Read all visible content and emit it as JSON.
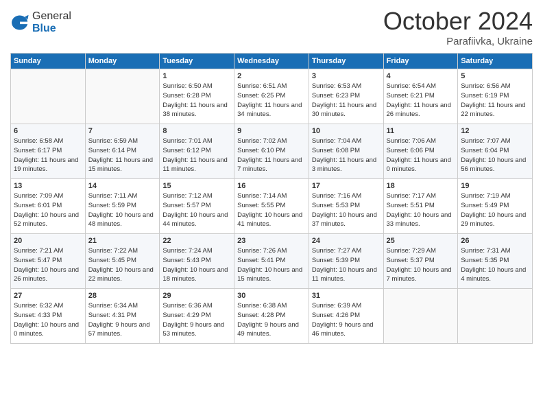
{
  "header": {
    "logo_general": "General",
    "logo_blue": "Blue",
    "month": "October 2024",
    "location": "Parafiivka, Ukraine"
  },
  "days_of_week": [
    "Sunday",
    "Monday",
    "Tuesday",
    "Wednesday",
    "Thursday",
    "Friday",
    "Saturday"
  ],
  "weeks": [
    [
      {
        "day": "",
        "sunrise": "",
        "sunset": "",
        "daylight": ""
      },
      {
        "day": "",
        "sunrise": "",
        "sunset": "",
        "daylight": ""
      },
      {
        "day": "1",
        "sunrise": "Sunrise: 6:50 AM",
        "sunset": "Sunset: 6:28 PM",
        "daylight": "Daylight: 11 hours and 38 minutes."
      },
      {
        "day": "2",
        "sunrise": "Sunrise: 6:51 AM",
        "sunset": "Sunset: 6:25 PM",
        "daylight": "Daylight: 11 hours and 34 minutes."
      },
      {
        "day": "3",
        "sunrise": "Sunrise: 6:53 AM",
        "sunset": "Sunset: 6:23 PM",
        "daylight": "Daylight: 11 hours and 30 minutes."
      },
      {
        "day": "4",
        "sunrise": "Sunrise: 6:54 AM",
        "sunset": "Sunset: 6:21 PM",
        "daylight": "Daylight: 11 hours and 26 minutes."
      },
      {
        "day": "5",
        "sunrise": "Sunrise: 6:56 AM",
        "sunset": "Sunset: 6:19 PM",
        "daylight": "Daylight: 11 hours and 22 minutes."
      }
    ],
    [
      {
        "day": "6",
        "sunrise": "Sunrise: 6:58 AM",
        "sunset": "Sunset: 6:17 PM",
        "daylight": "Daylight: 11 hours and 19 minutes."
      },
      {
        "day": "7",
        "sunrise": "Sunrise: 6:59 AM",
        "sunset": "Sunset: 6:14 PM",
        "daylight": "Daylight: 11 hours and 15 minutes."
      },
      {
        "day": "8",
        "sunrise": "Sunrise: 7:01 AM",
        "sunset": "Sunset: 6:12 PM",
        "daylight": "Daylight: 11 hours and 11 minutes."
      },
      {
        "day": "9",
        "sunrise": "Sunrise: 7:02 AM",
        "sunset": "Sunset: 6:10 PM",
        "daylight": "Daylight: 11 hours and 7 minutes."
      },
      {
        "day": "10",
        "sunrise": "Sunrise: 7:04 AM",
        "sunset": "Sunset: 6:08 PM",
        "daylight": "Daylight: 11 hours and 3 minutes."
      },
      {
        "day": "11",
        "sunrise": "Sunrise: 7:06 AM",
        "sunset": "Sunset: 6:06 PM",
        "daylight": "Daylight: 11 hours and 0 minutes."
      },
      {
        "day": "12",
        "sunrise": "Sunrise: 7:07 AM",
        "sunset": "Sunset: 6:04 PM",
        "daylight": "Daylight: 10 hours and 56 minutes."
      }
    ],
    [
      {
        "day": "13",
        "sunrise": "Sunrise: 7:09 AM",
        "sunset": "Sunset: 6:01 PM",
        "daylight": "Daylight: 10 hours and 52 minutes."
      },
      {
        "day": "14",
        "sunrise": "Sunrise: 7:11 AM",
        "sunset": "Sunset: 5:59 PM",
        "daylight": "Daylight: 10 hours and 48 minutes."
      },
      {
        "day": "15",
        "sunrise": "Sunrise: 7:12 AM",
        "sunset": "Sunset: 5:57 PM",
        "daylight": "Daylight: 10 hours and 44 minutes."
      },
      {
        "day": "16",
        "sunrise": "Sunrise: 7:14 AM",
        "sunset": "Sunset: 5:55 PM",
        "daylight": "Daylight: 10 hours and 41 minutes."
      },
      {
        "day": "17",
        "sunrise": "Sunrise: 7:16 AM",
        "sunset": "Sunset: 5:53 PM",
        "daylight": "Daylight: 10 hours and 37 minutes."
      },
      {
        "day": "18",
        "sunrise": "Sunrise: 7:17 AM",
        "sunset": "Sunset: 5:51 PM",
        "daylight": "Daylight: 10 hours and 33 minutes."
      },
      {
        "day": "19",
        "sunrise": "Sunrise: 7:19 AM",
        "sunset": "Sunset: 5:49 PM",
        "daylight": "Daylight: 10 hours and 29 minutes."
      }
    ],
    [
      {
        "day": "20",
        "sunrise": "Sunrise: 7:21 AM",
        "sunset": "Sunset: 5:47 PM",
        "daylight": "Daylight: 10 hours and 26 minutes."
      },
      {
        "day": "21",
        "sunrise": "Sunrise: 7:22 AM",
        "sunset": "Sunset: 5:45 PM",
        "daylight": "Daylight: 10 hours and 22 minutes."
      },
      {
        "day": "22",
        "sunrise": "Sunrise: 7:24 AM",
        "sunset": "Sunset: 5:43 PM",
        "daylight": "Daylight: 10 hours and 18 minutes."
      },
      {
        "day": "23",
        "sunrise": "Sunrise: 7:26 AM",
        "sunset": "Sunset: 5:41 PM",
        "daylight": "Daylight: 10 hours and 15 minutes."
      },
      {
        "day": "24",
        "sunrise": "Sunrise: 7:27 AM",
        "sunset": "Sunset: 5:39 PM",
        "daylight": "Daylight: 10 hours and 11 minutes."
      },
      {
        "day": "25",
        "sunrise": "Sunrise: 7:29 AM",
        "sunset": "Sunset: 5:37 PM",
        "daylight": "Daylight: 10 hours and 7 minutes."
      },
      {
        "day": "26",
        "sunrise": "Sunrise: 7:31 AM",
        "sunset": "Sunset: 5:35 PM",
        "daylight": "Daylight: 10 hours and 4 minutes."
      }
    ],
    [
      {
        "day": "27",
        "sunrise": "Sunrise: 6:32 AM",
        "sunset": "Sunset: 4:33 PM",
        "daylight": "Daylight: 10 hours and 0 minutes."
      },
      {
        "day": "28",
        "sunrise": "Sunrise: 6:34 AM",
        "sunset": "Sunset: 4:31 PM",
        "daylight": "Daylight: 9 hours and 57 minutes."
      },
      {
        "day": "29",
        "sunrise": "Sunrise: 6:36 AM",
        "sunset": "Sunset: 4:29 PM",
        "daylight": "Daylight: 9 hours and 53 minutes."
      },
      {
        "day": "30",
        "sunrise": "Sunrise: 6:38 AM",
        "sunset": "Sunset: 4:28 PM",
        "daylight": "Daylight: 9 hours and 49 minutes."
      },
      {
        "day": "31",
        "sunrise": "Sunrise: 6:39 AM",
        "sunset": "Sunset: 4:26 PM",
        "daylight": "Daylight: 9 hours and 46 minutes."
      },
      {
        "day": "",
        "sunrise": "",
        "sunset": "",
        "daylight": ""
      },
      {
        "day": "",
        "sunrise": "",
        "sunset": "",
        "daylight": ""
      }
    ]
  ]
}
